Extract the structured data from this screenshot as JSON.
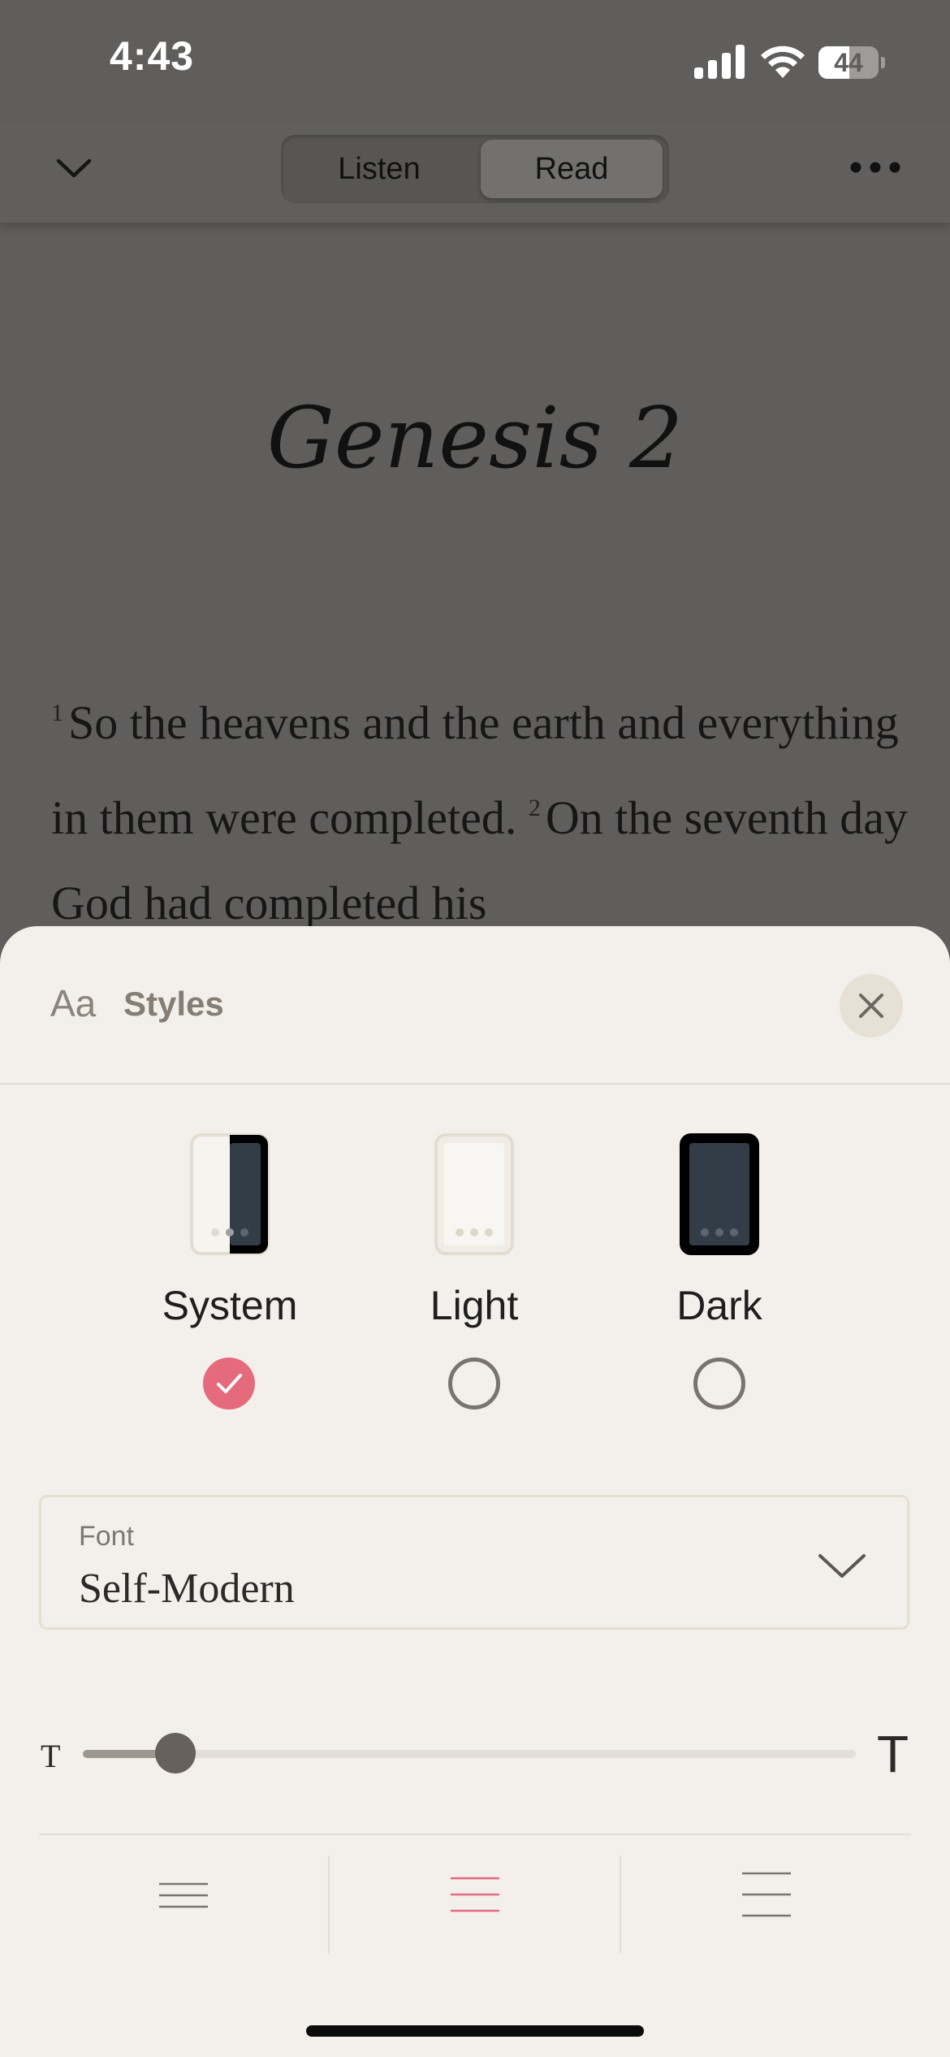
{
  "status_bar": {
    "time": "4:43",
    "battery": "44"
  },
  "nav": {
    "segments": [
      {
        "label": "Listen",
        "selected": false
      },
      {
        "label": "Read",
        "selected": true
      }
    ]
  },
  "reader": {
    "chapter_title": "Genesis 2",
    "verses": [
      {
        "num": "1",
        "text": "So the heavens and the earth and everything in them were completed."
      },
      {
        "num": "2",
        "text": "On the seventh day God had completed his"
      }
    ]
  },
  "styles_sheet": {
    "aa_label": "Aa",
    "title": "Styles",
    "themes": [
      {
        "label": "System",
        "selected": true
      },
      {
        "label": "Light",
        "selected": false
      },
      {
        "label": "Dark",
        "selected": false
      }
    ],
    "font": {
      "caption": "Font",
      "value": "Self-Modern"
    },
    "text_size": {
      "small_label": "T",
      "large_label": "T",
      "value_fraction": 0.12
    },
    "line_spacing": [
      "compact",
      "normal",
      "loose"
    ],
    "selected_line_spacing": "normal",
    "accent_color": "#e56b7c"
  },
  "icons": {
    "back": "chevron-down-icon",
    "more": "more-horizontal-icon",
    "close": "close-icon",
    "font_dropdown": "chevron-down-icon",
    "checked": "check-icon"
  }
}
